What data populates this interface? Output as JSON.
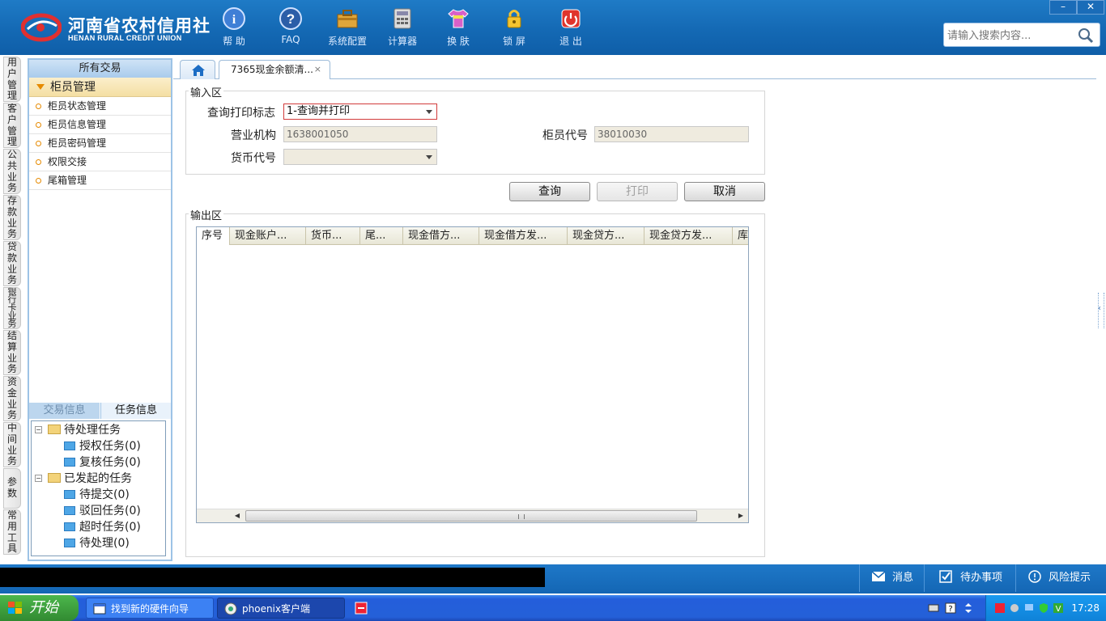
{
  "header": {
    "logo_cn": "河南省农村信用社",
    "logo_en": "HENAN RURAL CREDIT UNION",
    "tools": [
      {
        "label": "帮 助",
        "icon": "info-icon"
      },
      {
        "label": "FAQ",
        "icon": "question-icon"
      },
      {
        "label": "系统配置",
        "icon": "toolbox-icon"
      },
      {
        "label": "计算器",
        "icon": "calculator-icon"
      },
      {
        "label": "换 肤",
        "icon": "tshirt-icon"
      },
      {
        "label": "锁 屏",
        "icon": "lock-icon"
      },
      {
        "label": "退 出",
        "icon": "power-icon"
      }
    ],
    "window_minimize": "–",
    "window_close": "✕",
    "search_placeholder": "请输入搜索内容..."
  },
  "vertical_tabs": [
    "用户管理",
    "客户管理",
    "公共业务",
    "存款业务",
    "贷款业务",
    "银行卡业务",
    "结算业务",
    "资金业务",
    "中间业务",
    "参数",
    "常用工具"
  ],
  "left_panel": {
    "header": "所有交易",
    "group": "柜员管理",
    "items": [
      "柜员状态管理",
      "柜员信息管理",
      "柜员密码管理",
      "权限交接",
      "尾箱管理"
    ],
    "tabs": [
      "交易信息",
      "任务信息"
    ],
    "tree": {
      "pending_label": "待处理任务",
      "pending_children": [
        "授权任务(0)",
        "复核任务(0)"
      ],
      "initiated_label": "已发起的任务",
      "initiated_children": [
        "待提交(0)",
        "驳回任务(0)",
        "超时任务(0)",
        "待处理(0)"
      ]
    }
  },
  "tabs": {
    "home_icon": "home-icon",
    "active_tab": "7365现金余额清...",
    "close": "×"
  },
  "input_area": {
    "title": "输入区",
    "query_print_label": "查询打印标志",
    "query_print_value": "1-查询并打印",
    "branch_label": "营业机构",
    "branch_value": "1638001050",
    "teller_label": "柜员代号",
    "teller_value": "38010030",
    "currency_label": "货币代号",
    "currency_value": ""
  },
  "buttons": {
    "query": "查询",
    "print": "打印",
    "cancel": "取消"
  },
  "output_area": {
    "title": "输出区",
    "columns": [
      "序号",
      "现金账户...",
      "货币...",
      "尾...",
      "现金借方...",
      "现金借方发...",
      "现金贷方...",
      "现金贷方发...",
      "库"
    ]
  },
  "status_bar": {
    "message": "消息",
    "todo": "待办事项",
    "risk": "风险提示"
  },
  "taskbar": {
    "start": "开始",
    "tasks": [
      "找到新的硬件向导",
      "phoenix客户端"
    ],
    "clock": "17:28"
  }
}
